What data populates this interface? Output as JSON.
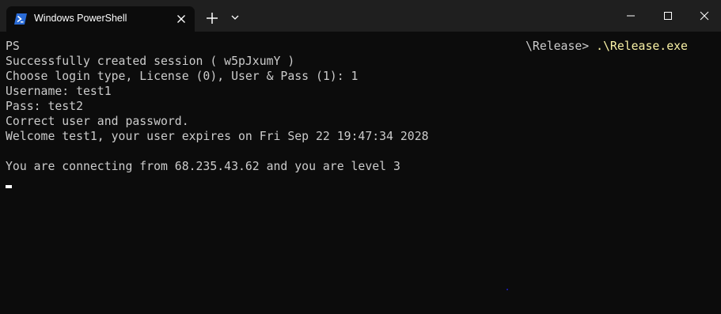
{
  "app": {
    "tab_title": "Windows PowerShell"
  },
  "terminal": {
    "prompt_prefix": "PS",
    "prompt_path": "\\Release>",
    "command": ".\\Release.exe",
    "lines": [
      "Successfully created session ( w5pJxumY )",
      "Choose login type, License (0), User & Pass (1): 1",
      "Username: test1",
      "Pass: test2",
      "Correct user and password.",
      "Welcome test1, your user expires on Fri Sep 22 19:47:34 2028",
      "",
      "You are connecting from 68.235.43.62 and you are level 3"
    ]
  },
  "colors": {
    "background": "#0c0c0c",
    "titlebar": "#1f1f1f",
    "text": "#cccccc",
    "command": "#f9f1a5",
    "powershell_icon": "#2a6bd6"
  },
  "icons": {
    "tab": "powershell-icon",
    "tab_close": "close-icon",
    "new_tab": "plus-icon",
    "dropdown": "chevron-down-icon",
    "minimize": "minimize-icon",
    "maximize": "maximize-icon",
    "close": "close-icon"
  }
}
